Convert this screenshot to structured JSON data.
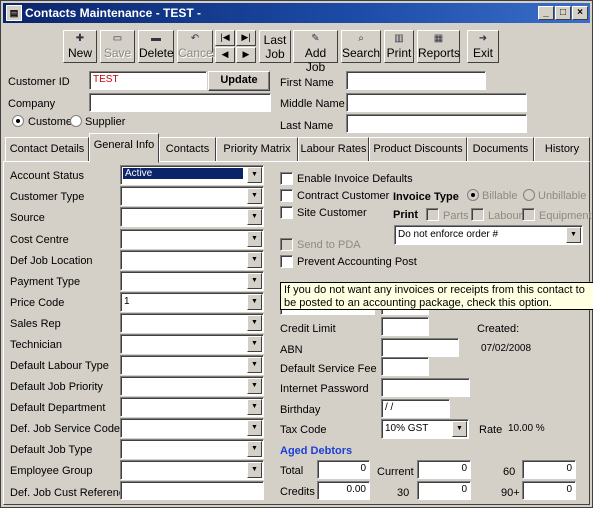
{
  "window": {
    "title": "Contacts Maintenance - TEST -",
    "app_icon": "app-icon",
    "min": "_",
    "max": "□",
    "close": "×"
  },
  "toolbar": [
    {
      "label": "New",
      "icon": "new-icon",
      "enabled": true
    },
    {
      "label": "Save",
      "icon": "save-icon",
      "enabled": false
    },
    {
      "label": "Delete",
      "icon": "delete-icon",
      "enabled": true
    },
    {
      "label": "Cancel",
      "icon": "cancel-icon",
      "enabled": false
    },
    {
      "label": "Last Job",
      "icon": "last-job-icon",
      "enabled": true
    },
    {
      "label": "Add Job",
      "icon": "add-job-icon",
      "enabled": true
    },
    {
      "label": "Search",
      "icon": "search-icon",
      "enabled": true
    },
    {
      "label": "Print",
      "icon": "print-icon",
      "enabled": true
    },
    {
      "label": "Reports",
      "icon": "reports-icon",
      "enabled": true
    },
    {
      "label": "Exit",
      "icon": "exit-icon",
      "enabled": true
    }
  ],
  "nav": {
    "first": "|◀",
    "last": "▶|",
    "prev": "◀",
    "next": "▶"
  },
  "header": {
    "customer_id_label": "Customer ID",
    "customer_id": "TEST",
    "update_button": "Update",
    "company_label": "Company",
    "company": "",
    "customer_radio": "Customer",
    "supplier_radio": "Supplier",
    "first_name_label": "First Name",
    "middle_name_label": "Middle Name",
    "last_name_label": "Last Name"
  },
  "tabs": [
    "Contact Details",
    "General Info",
    "Contacts",
    "Priority Matrix",
    "Labour Rates",
    "Product Discounts",
    "Documents",
    "History"
  ],
  "active_tab": "General Info",
  "left_fields": [
    {
      "label": "Account Status",
      "value": "Active"
    },
    {
      "label": "Customer Type",
      "value": ""
    },
    {
      "label": "Source",
      "value": ""
    },
    {
      "label": "Cost Centre",
      "value": ""
    },
    {
      "label": "Def Job Location",
      "value": ""
    },
    {
      "label": "Payment Type",
      "value": ""
    },
    {
      "label": "Price Code",
      "value": "1"
    },
    {
      "label": "Sales Rep",
      "value": ""
    },
    {
      "label": "Technician",
      "value": ""
    },
    {
      "label": "Default Labour Type",
      "value": ""
    },
    {
      "label": "Default Job Priority",
      "value": ""
    },
    {
      "label": "Default Department",
      "value": ""
    },
    {
      "label": "Def. Job Service Code",
      "value": ""
    },
    {
      "label": "Default Job Type",
      "value": ""
    },
    {
      "label": "Employee Group",
      "value": ""
    },
    {
      "label": "Def. Job Cust Reference",
      "value": ""
    }
  ],
  "checks": {
    "enable_invoice_defaults": "Enable Invoice Defaults",
    "contract_customer": "Contract Customer",
    "site_customer": "Site Customer",
    "send_to_pda": "Send to PDA",
    "prevent_accounting_post": "Prevent Accounting Post"
  },
  "invoice_type": {
    "label": "Invoice Type",
    "billable": "Billable",
    "unbillable": "Unbillable"
  },
  "print": {
    "label": "Print",
    "parts": "Parts",
    "labour": "Labour",
    "equipment": "Equipment"
  },
  "order_combo": "Do not enforce order #",
  "tooltip": "If you do not want any invoices or receipts from this contact to be posted to an accounting package, check this option.",
  "right_fields": {
    "credit_limit": "Credit Limit",
    "created_label": "Created:",
    "created_date": "07/02/2008",
    "abn": "ABN",
    "default_service_fee": "Default Service Fee",
    "internet_password": "Internet Password",
    "birthday": "Birthday",
    "birthday_value": " / /",
    "tax_code_label": "Tax Code",
    "tax_code": "10% GST",
    "rate_label": "Rate",
    "rate_value": "10.00 %"
  },
  "aged_debtors": {
    "title": "Aged Debtors",
    "total_label": "Total",
    "total": "0",
    "credits_label": "Credits",
    "credits": "0.00",
    "current_label": "Current",
    "current": "0",
    "d30_label": "30",
    "d30": "0",
    "d60_label": "60",
    "d60": "0",
    "d90_label": "90+",
    "d90": "0"
  },
  "colors": {
    "title_bar": "#0a246a",
    "face": "#d4d0c8",
    "id_text": "#cc0000",
    "aged_title": "#1c3fd6",
    "tooltip_bg": "#ffffe1"
  }
}
